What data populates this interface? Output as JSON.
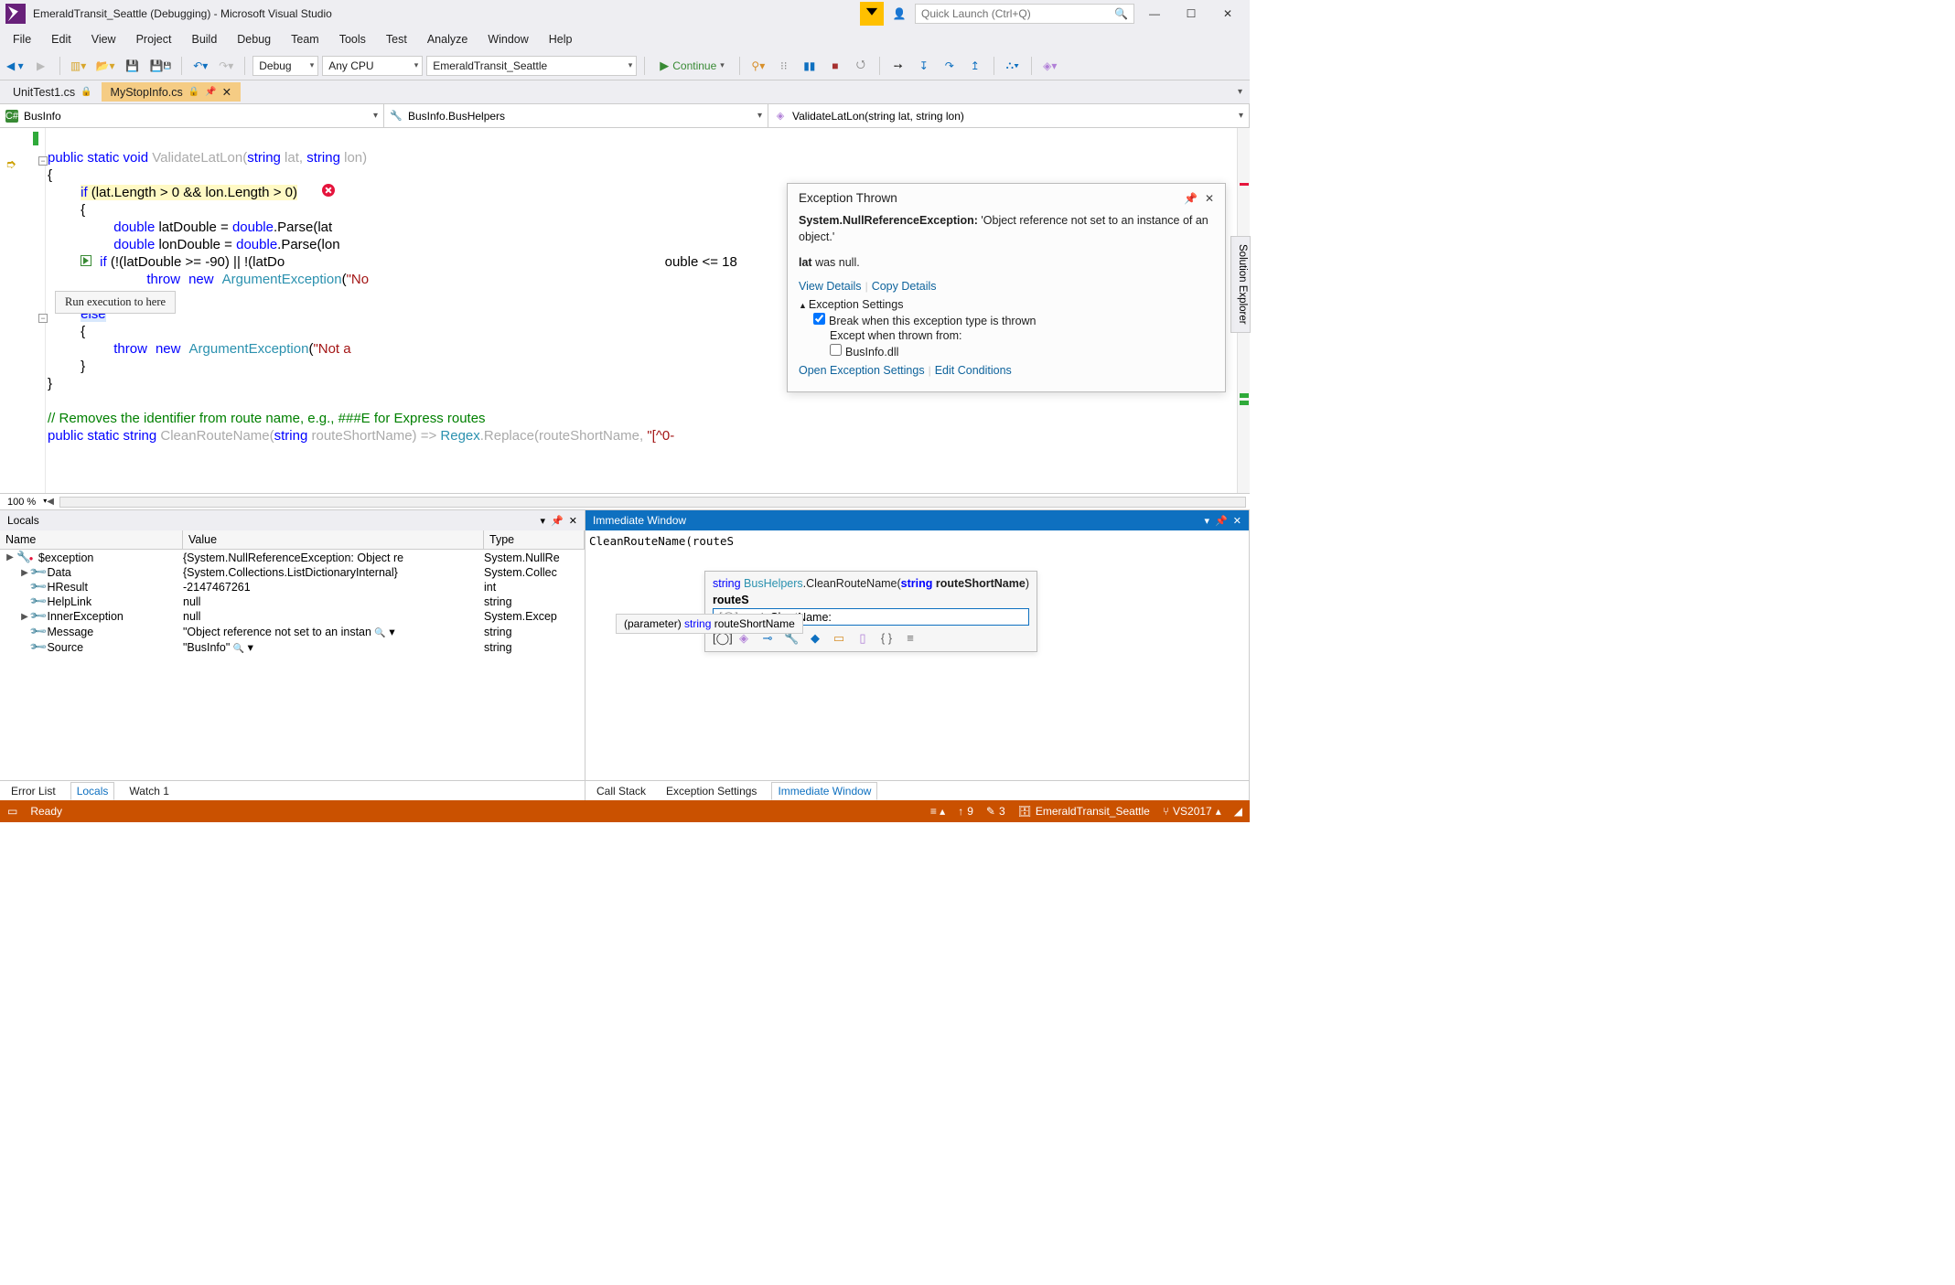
{
  "title": "EmeraldTransit_Seattle (Debugging) - Microsoft Visual Studio",
  "quick_launch_placeholder": "Quick Launch (Ctrl+Q)",
  "menu": [
    "File",
    "Edit",
    "View",
    "Project",
    "Build",
    "Debug",
    "Team",
    "Tools",
    "Test",
    "Analyze",
    "Window",
    "Help"
  ],
  "toolbar": {
    "config": "Debug",
    "platform": "Any CPU",
    "startup": "EmeraldTransit_Seattle",
    "continue": "Continue"
  },
  "tabs": {
    "inactive": "UnitTest1.cs",
    "active": "MyStopInfo.cs"
  },
  "nav": {
    "left": "BusInfo",
    "mid": "BusInfo.BusHelpers",
    "right": "ValidateLatLon(string lat, string lon)"
  },
  "code": {
    "l1_a": "public static void",
    "l1_b": " ValidateLatLon(",
    "l1_c": "string",
    "l1_d": " lat, ",
    "l1_e": "string",
    "l1_f": " lon)",
    "l2": "{",
    "l3_a": "if",
    "l3_b": " (lat.Length > 0 && lon.Length > 0)",
    "l4": "{",
    "l5_a": "double",
    "l5_b": " latDouble = ",
    "l5_c": "double",
    "l5_d": ".Parse(lat",
    "l6_a": "double",
    "l6_b": " lonDouble = ",
    "l6_c": "double",
    "l6_d": ".Parse(lon",
    "l7_a": "if",
    "l7_b": " (!(latDouble >= -90) || !(latDo",
    "l7_c": "ouble <= 18",
    "l8_a": "throw",
    "l8_b": "new",
    "l8_c": "ArgumentException",
    "l8_d": "(",
    "l8_e": "\"No",
    "l10_a": "else",
    "l11": "{",
    "l12_a": "throw",
    "l12_b": "new",
    "l12_c": "ArgumentException",
    "l12_d": "(",
    "l12_e": "\"Not a",
    "l13": "}",
    "l14": "}",
    "cmt": "// Removes the identifier from route name, e.g., ###E for Express routes",
    "l16_a": "public static string",
    "l16_b": " CleanRouteName(",
    "l16_c": "string",
    "l16_d": " routeShortName) => ",
    "l16_e": "Regex",
    "l16_f": ".Replace(routeShortName, ",
    "l16_g": "\"[^0-"
  },
  "tooltip": "Run execution to here",
  "zoom": "100 %",
  "exception": {
    "title": "Exception Thrown",
    "heading": "System.NullReferenceException:",
    "body": " 'Object reference not set to an instance of an object.'",
    "var": "lat",
    "var_suffix": " was null.",
    "view_details": "View Details",
    "copy_details": "Copy Details",
    "settings_title": "Exception Settings",
    "break_label": "Break when this exception type is thrown",
    "except_label": "Except when thrown from:",
    "module": "BusInfo.dll",
    "open_settings": "Open Exception Settings",
    "edit_cond": "Edit Conditions"
  },
  "locals": {
    "title": "Locals",
    "cols": [
      "Name",
      "Value",
      "Type"
    ],
    "rows": [
      {
        "indent": 0,
        "exp": "▶",
        "icon": "err",
        "name": "$exception",
        "value": "{System.NullReferenceException: Object re",
        "type": "System.NullRe"
      },
      {
        "indent": 1,
        "exp": "▶",
        "icon": "w",
        "name": "Data",
        "value": "{System.Collections.ListDictionaryInternal}",
        "type": "System.Collec"
      },
      {
        "indent": 1,
        "exp": "",
        "icon": "w",
        "name": "HResult",
        "value": "-2147467261",
        "type": "int"
      },
      {
        "indent": 1,
        "exp": "",
        "icon": "w",
        "name": "HelpLink",
        "value": "null",
        "type": "string"
      },
      {
        "indent": 1,
        "exp": "▶",
        "icon": "w",
        "name": "InnerException",
        "value": "null",
        "type": "System.Excep"
      },
      {
        "indent": 1,
        "exp": "",
        "icon": "w",
        "name": "Message",
        "value": "\"Object reference not set to an instan",
        "type": "string",
        "mag": true
      },
      {
        "indent": 1,
        "exp": "",
        "icon": "w",
        "name": "Source",
        "value": "\"BusInfo\"",
        "type": "string",
        "mag": true
      }
    ]
  },
  "btm_left_tabs": [
    "Error List",
    "Locals",
    "Watch 1"
  ],
  "immediate": {
    "title": "Immediate Window",
    "input": "CleanRouteName(routeS",
    "sig_pre": "string ",
    "sig_cls": "BusHelpers",
    "sig_dot": ".CleanRouteName(",
    "sig_kw": "string ",
    "sig_param": "routeShortName",
    "sig_post": ")",
    "param_tip_pre": "(parameter) ",
    "param_tip_kw": "string",
    "param_tip_name": " routeShortName",
    "list_title": "routeS",
    "list_item": "routeShortName:"
  },
  "btm_right_tabs": [
    "Call Stack",
    "Exception Settings",
    "Immediate Window"
  ],
  "status": {
    "ready": "Ready",
    "changes": "9",
    "edits": "3",
    "repo": "EmeraldTransit_Seattle",
    "vs": "VS2017"
  },
  "side_panel": "Solution Explorer"
}
